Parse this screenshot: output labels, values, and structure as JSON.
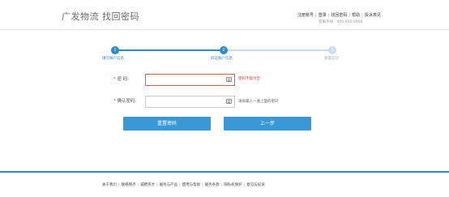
{
  "header": {
    "brand": "广发物流 找回密码",
    "links": [
      "注册账号",
      "登录",
      "找回密码",
      "帮助",
      "投诉意见"
    ],
    "hotline": "客服热线：400-000-0000"
  },
  "steps": [
    {
      "num": "1",
      "label": "填写账户信息",
      "state": "done"
    },
    {
      "num": "2",
      "label": "验证账户信息",
      "state": "active"
    },
    {
      "num": "3",
      "label": "重置成功",
      "state": "pending"
    }
  ],
  "form": {
    "password": {
      "star": "*",
      "label": "密      码:",
      "value": "",
      "error": "密码不能为空"
    },
    "confirm": {
      "star": "*",
      "label": "确认密码:",
      "value": "",
      "hint": "请再输入一遍上面的密码"
    }
  },
  "buttons": {
    "reset": "重置密码",
    "back": "上一步"
  },
  "footer": {
    "links": [
      "关于我们",
      "联络网点",
      "诚聘英才",
      "服务与产品",
      "使用与帮助",
      "服务条款",
      "隐私权保护",
      "意见与投诉"
    ]
  },
  "colors": {
    "accent": "#2a8ad4",
    "error": "#e03a3a",
    "button": "#3a98d7",
    "pending": "#c7dcef"
  }
}
